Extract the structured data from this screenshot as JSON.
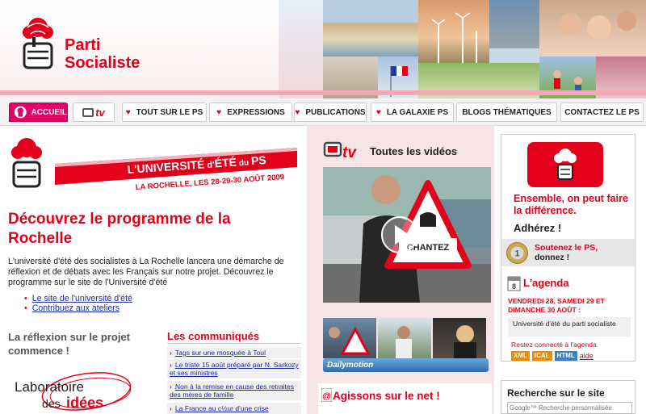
{
  "brand": {
    "line1": "Parti",
    "line2": "Socialiste",
    "color": "#e2001a"
  },
  "nav": {
    "tabs": [
      {
        "label": "ACCUEIL",
        "active": true
      },
      {
        "label": "tv",
        "icon": "tv-icon"
      },
      {
        "label": "TOUT SUR LE PS"
      },
      {
        "label": "EXPRESSIONS"
      },
      {
        "label": "PUBLICATIONS"
      },
      {
        "label": "LA GALAXIE PS"
      },
      {
        "label": "BLOGS THÉMATIQUES"
      },
      {
        "label": "CONTACTEZ LE PS"
      }
    ]
  },
  "banner": {
    "title_l": "L'",
    "title_univ": "UNIVERSITÉ",
    "title_d": "d'",
    "title_ete": "ÉTÉ",
    "title_du": "du",
    "title_ps": "PS",
    "subtitle": "LA ROCHELLE, LES 28-29-30 AOÛT 2009"
  },
  "main": {
    "title": "Découvrez le programme de la Rochelle",
    "intro": "L'université d'été des socialistes à La Rochelle lancera une démarche de réflexion et de débats avec les Français sur notre projet. Découvrez le programme sur le site de l'Université d'été",
    "links": [
      "Le site de l'université d'été",
      "Contribuez aux ateliers"
    ]
  },
  "reflexion": {
    "title": "La réflexion sur le projet commence !",
    "labo_line1": "Laboratoire",
    "labo_des": "des",
    "labo_idees": "idées"
  },
  "communiques": {
    "title": "Les communiqués",
    "items": [
      "Tags sur une mosquée à Toul",
      "Le triste 15 août préparé par N. Sarkozy et ses ministres",
      "Non à la remise en cause des retraites des mères de famille",
      "La France au c½ur d'une crise"
    ]
  },
  "videos": {
    "title": "Toutes les vidéos",
    "sign_text": "CHANTEZ",
    "provider": "Dailymotion"
  },
  "agissons": {
    "title": "Agissons sur le net !"
  },
  "adhesion": {
    "text": "Ensemble, on peut faire la différence.",
    "cta": "Adhérez !"
  },
  "soutien": {
    "line1": "Soutenez le PS,",
    "line2": "donnez !"
  },
  "agenda": {
    "title": "L'agenda",
    "date": "VENDREDI 28, SAMEDI 29 ET DIMANCHE 30 AOÛT :",
    "event": "Université d'été du parti socialiste",
    "connect": "Restez connecté à l'agenda",
    "feeds": [
      {
        "label": "XML",
        "color": "#f08a00"
      },
      {
        "label": "ICAL",
        "color": "#f08a00"
      },
      {
        "label": "HTML",
        "color": "#3a7fc1"
      }
    ],
    "help": "aide"
  },
  "search": {
    "title": "Recherche sur le site",
    "placeholder": "Google™ Recherche personnalisée"
  }
}
